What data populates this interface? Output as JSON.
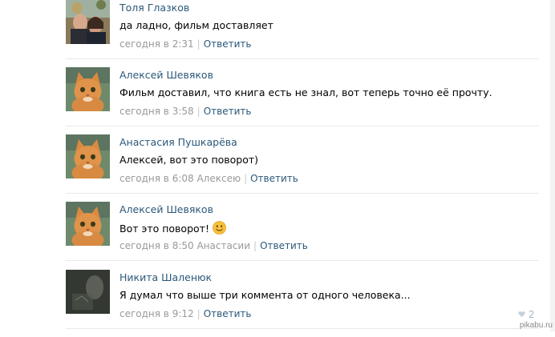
{
  "comments": [
    {
      "author": "Толя Глазков",
      "text": "да ладно, фильм доставляет",
      "time": "сегодня в 2:31",
      "reply_to": "",
      "reply_label": "Ответить",
      "avatar": "couple-photo"
    },
    {
      "author": "Алексей Шевяков",
      "text": "Фильм доставил, что книга есть не знал, вот теперь точно её прочту.",
      "time": "сегодня в 3:58",
      "reply_to": "",
      "reply_label": "Ответить",
      "avatar": "cat-photo"
    },
    {
      "author": "Анастасия Пушкарёва",
      "text": "Алексей, вот это поворот)",
      "time": "сегодня в 6:08",
      "reply_to": "Алексею",
      "reply_label": "Ответить",
      "avatar": "cat-photo"
    },
    {
      "author": "Алексей Шевяков",
      "text": "Вот это поворот!",
      "time": "сегодня в 8:50",
      "reply_to": "Анастасии",
      "reply_label": "Ответить",
      "avatar": "cat-photo",
      "emoji": "smile-emoji"
    },
    {
      "author": "Никита Шаленюк",
      "text": "Я думал что выше три коммента от одного человека...",
      "time": "сегодня в 9:12",
      "reply_to": "",
      "reply_label": "Ответить",
      "avatar": "dark-photo"
    }
  ],
  "likes": {
    "count": "2",
    "icon": "heart-icon"
  },
  "watermark": "pikabu.ru",
  "colors": {
    "link": "#2b587a",
    "meta": "#999999",
    "divider": "#e5e9ef"
  }
}
